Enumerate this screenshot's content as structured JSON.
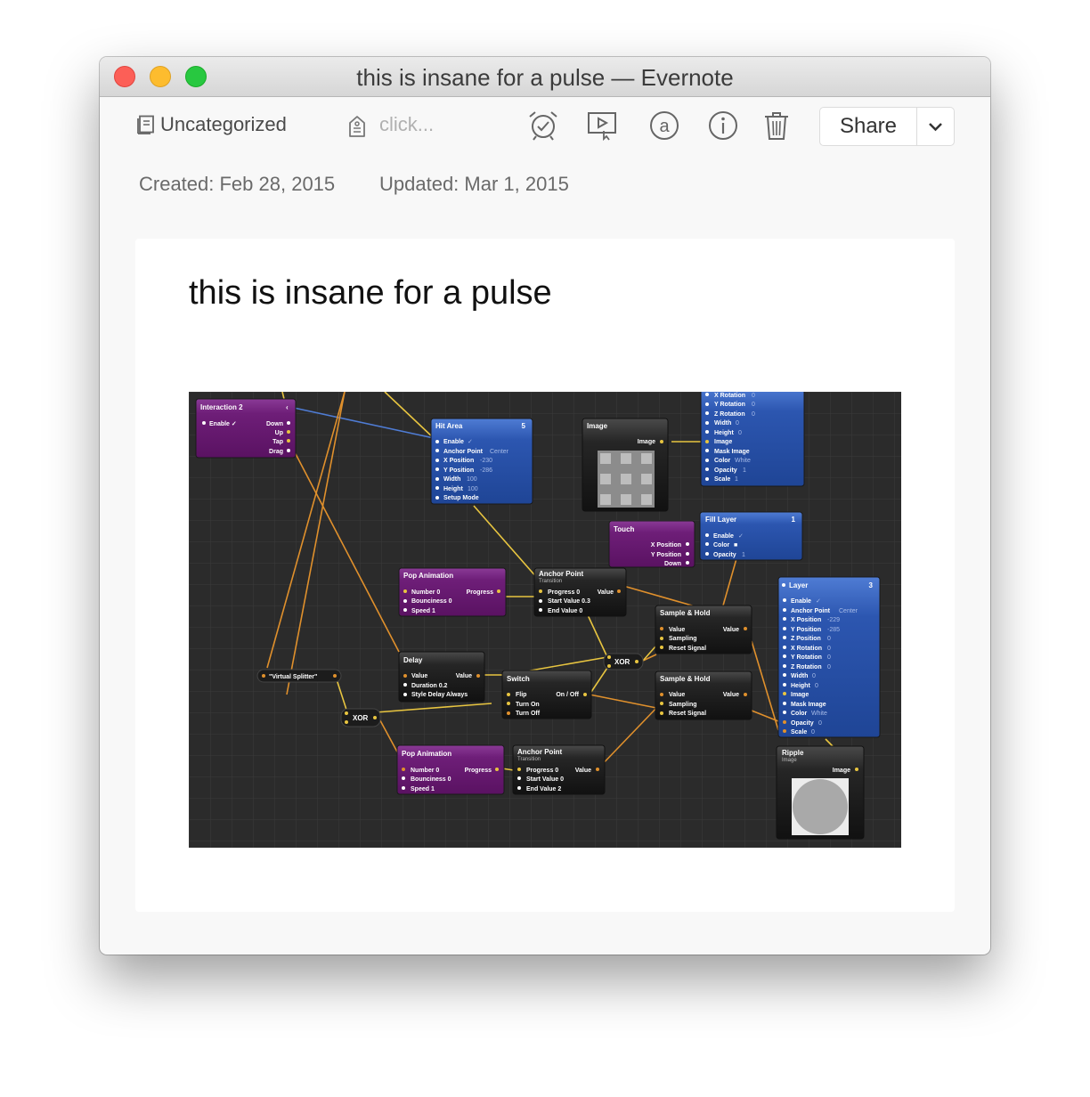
{
  "window": {
    "title": "this is insane for a pulse — Evernote"
  },
  "toolbar": {
    "notebook": "Uncategorized",
    "tag_placeholder": "click...",
    "icons": [
      "notebook-icon",
      "tag-icon",
      "reminder-alarm-icon",
      "presentation-icon",
      "at-sign-icon",
      "info-icon",
      "trash-icon",
      "chevron-down-icon"
    ],
    "share_label": "Share"
  },
  "meta": {
    "created": "Created: Feb 28, 2015",
    "updated": "Updated: Mar 1, 2015"
  },
  "note": {
    "title": "this is insane for a pulse"
  },
  "graph": {
    "interaction2": {
      "title": "Interaction 2",
      "left": [
        "Enable ✓"
      ],
      "right": [
        "Down",
        "Up",
        "Tap",
        "Drag"
      ]
    },
    "hit_area": {
      "title": "Hit Area",
      "badge": "5",
      "rows": [
        [
          "Enable",
          "✓"
        ],
        [
          "Anchor Point",
          "Center"
        ],
        [
          "X Position",
          "-230"
        ],
        [
          "Y Position",
          "-286"
        ],
        [
          "Width",
          "100"
        ],
        [
          "Height",
          "100"
        ],
        [
          "Setup Mode",
          ""
        ]
      ]
    },
    "image": {
      "title": "Image",
      "out": "Image"
    },
    "layer_top": {
      "rows": [
        [
          "X Rotation",
          "0"
        ],
        [
          "Y Rotation",
          "0"
        ],
        [
          "Z Rotation",
          "0"
        ],
        [
          "Width",
          "0"
        ],
        [
          "Height",
          "0"
        ],
        [
          "Image",
          ""
        ],
        [
          "Mask Image",
          ""
        ],
        [
          "Color",
          "White"
        ],
        [
          "Opacity",
          "1"
        ],
        [
          "Scale",
          "1"
        ]
      ]
    },
    "touch": {
      "title": "Touch",
      "right": [
        "X Position",
        "Y Position",
        "Down"
      ]
    },
    "fill_layer": {
      "title": "Fill Layer",
      "badge": "1",
      "rows": [
        [
          "Enable",
          "✓"
        ],
        [
          "Color",
          "■"
        ],
        [
          "Opacity",
          "1"
        ]
      ]
    },
    "pop1": {
      "title": "Pop Animation",
      "left": [
        "Number 0",
        "Bounciness 0",
        "Speed 1"
      ],
      "out": "Progress"
    },
    "anchor1": {
      "title": "Anchor Point",
      "sub": "Transition",
      "left": [
        "Progress 0",
        "Start Value 0.3",
        "End Value 0"
      ],
      "out": "Value"
    },
    "sample1": {
      "title": "Sample & Hold",
      "left": [
        "Value",
        "Sampling",
        "Reset Signal"
      ],
      "out": "Value"
    },
    "layer": {
      "title": "Layer",
      "badge": "3",
      "rows": [
        [
          "Enable",
          "✓"
        ],
        [
          "Anchor Point",
          "Center"
        ],
        [
          "X Position",
          "-229"
        ],
        [
          "Y Position",
          "-285"
        ],
        [
          "Z Position",
          "0"
        ],
        [
          "X Rotation",
          "0"
        ],
        [
          "Y Rotation",
          "0"
        ],
        [
          "Z Rotation",
          "0"
        ],
        [
          "Width",
          "0"
        ],
        [
          "Height",
          "0"
        ],
        [
          "Image",
          ""
        ],
        [
          "Mask Image",
          ""
        ],
        [
          "Color",
          "White"
        ],
        [
          "Opacity",
          "0"
        ],
        [
          "Scale",
          "0"
        ]
      ]
    },
    "splitter": {
      "title": "\"Virtual Splitter\""
    },
    "delay": {
      "title": "Delay",
      "left": [
        "Value",
        "Duration 0.2",
        "Style Delay Always"
      ],
      "out": "Value"
    },
    "switch": {
      "title": "Switch",
      "left": [
        "Flip",
        "Turn On",
        "Turn Off"
      ],
      "out": "On / Off"
    },
    "xor1": "XOR",
    "xor2": "XOR",
    "sample2": {
      "title": "Sample & Hold",
      "left": [
        "Value",
        "Sampling",
        "Reset Signal"
      ],
      "out": "Value"
    },
    "pop2": {
      "title": "Pop Animation",
      "left": [
        "Number 0",
        "Bounciness 0",
        "Speed 1"
      ],
      "out": "Progress"
    },
    "anchor2": {
      "title": "Anchor Point",
      "sub": "Transition",
      "left": [
        "Progress 0",
        "Start Value 0",
        "End Value 2"
      ],
      "out": "Value"
    },
    "ripple": {
      "title": "Ripple",
      "sub": "Image",
      "out": "Image"
    }
  }
}
